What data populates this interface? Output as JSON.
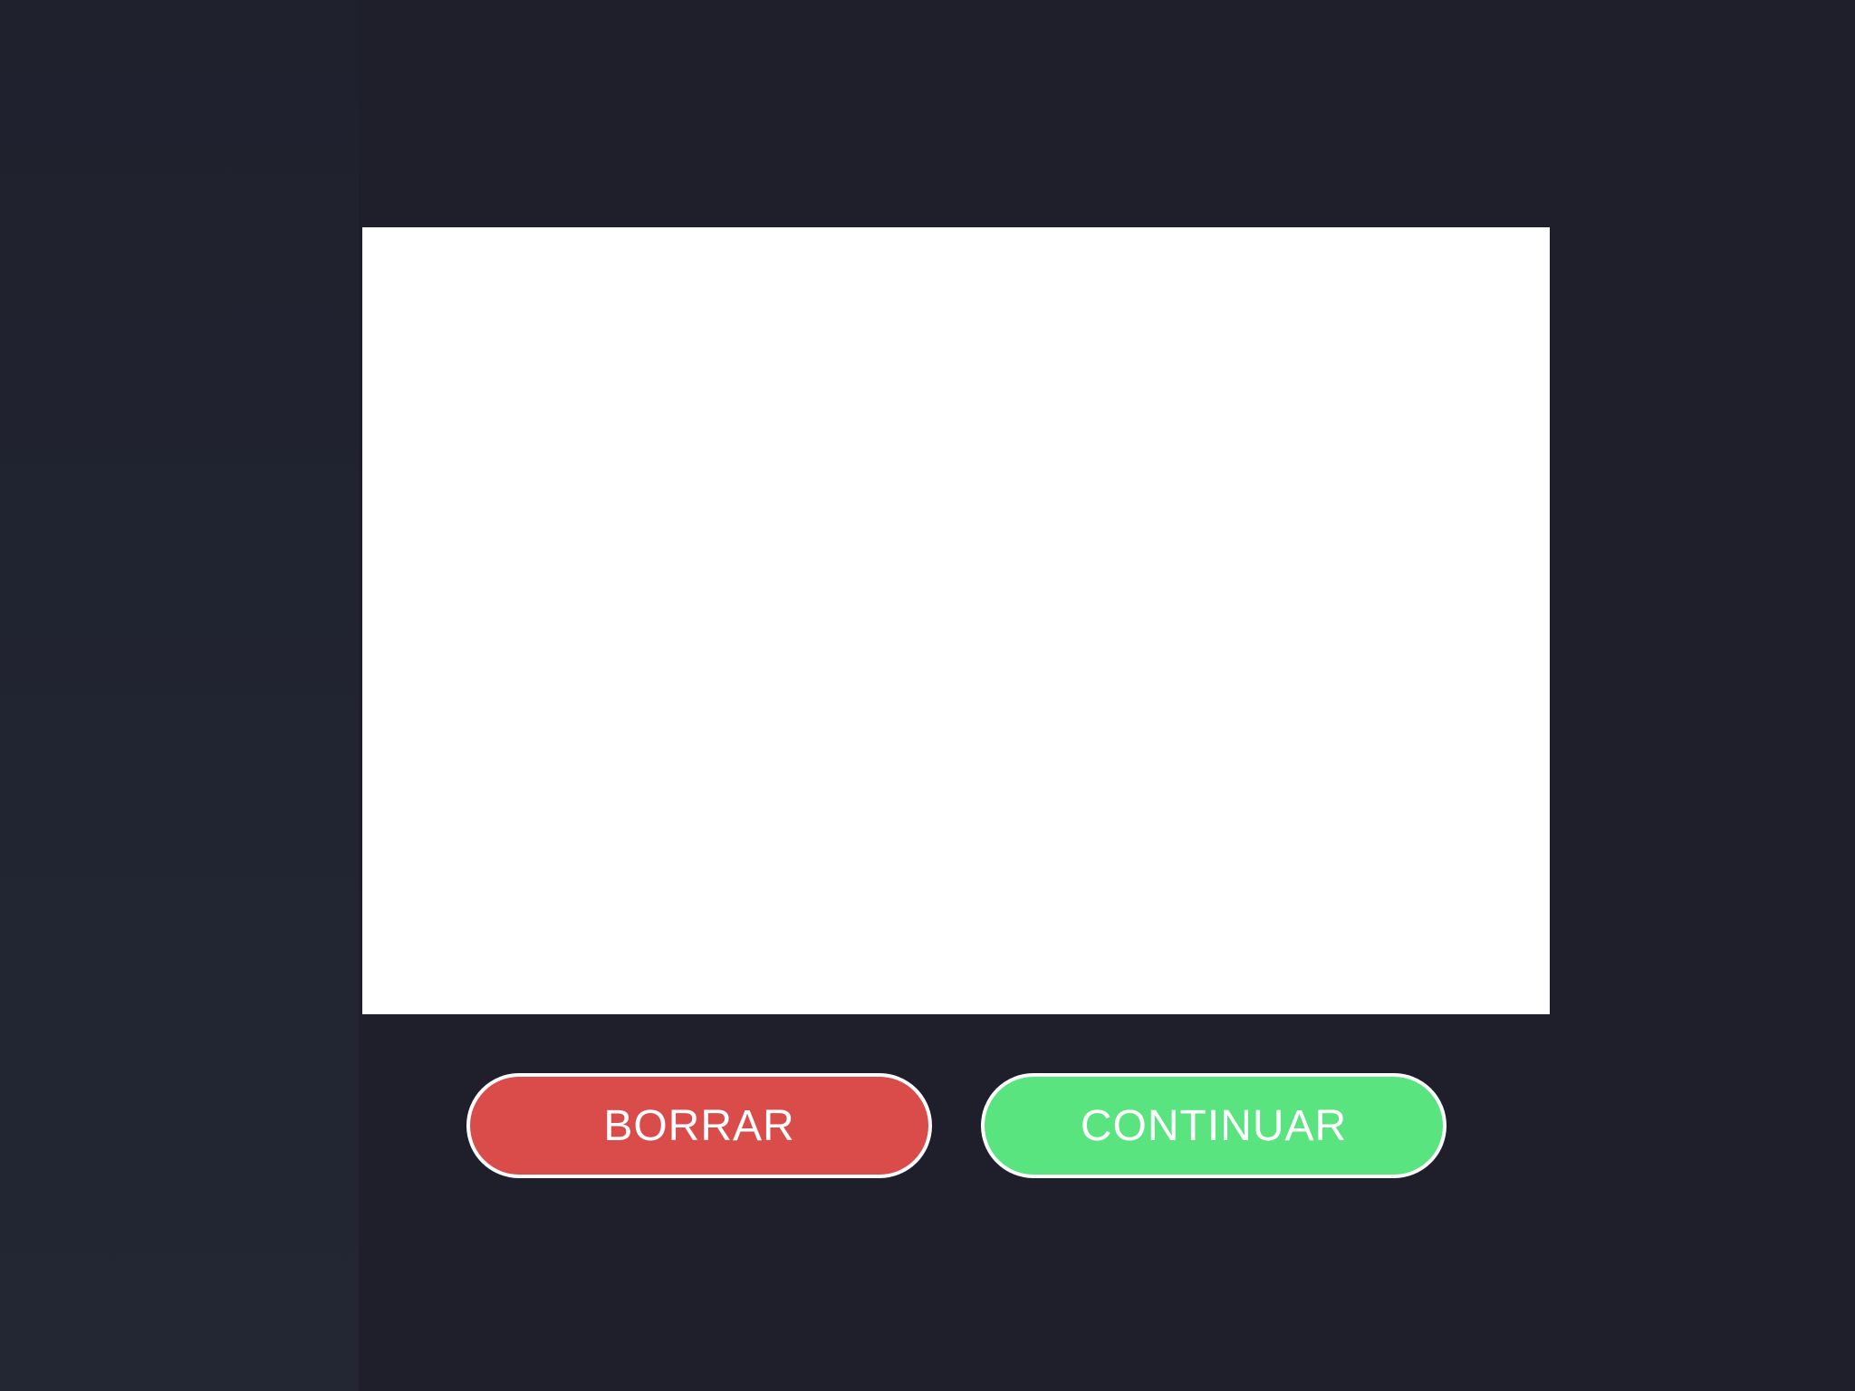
{
  "colors": {
    "background": "#1f212e",
    "left_strip": "#222633",
    "canvas": "#ffffff",
    "clear_button": "#d94c4a",
    "continue_button": "#59e47f",
    "button_border": "#ffffff",
    "button_text": "#ffffff"
  },
  "actions": {
    "clear_label": "BORRAR",
    "continue_label": "CONTINUAR"
  }
}
